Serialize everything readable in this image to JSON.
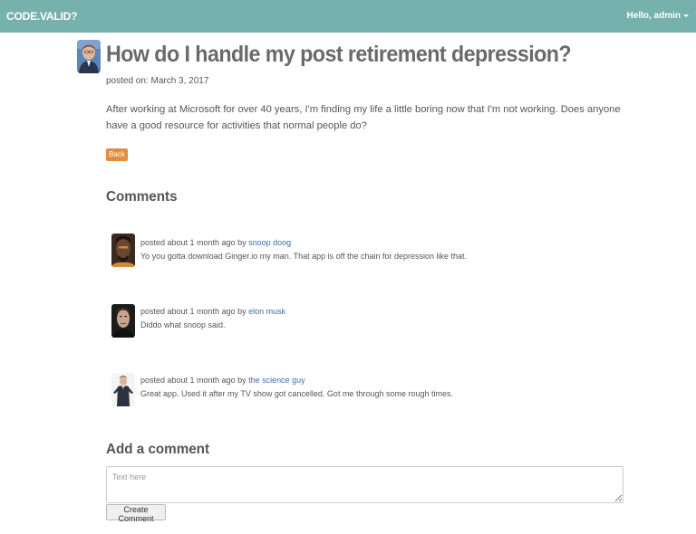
{
  "navbar": {
    "brand": "CODE.VALID?",
    "user_greeting": "Hello, admin"
  },
  "post": {
    "title": "How do I handle my post retirement depression?",
    "posted_on": "posted on: March 3, 2017",
    "body": "After working at Microsoft for over 40 years, I'm finding my life a little boring now that I'm not working. Does anyone have a good resource for activities that normal people do?",
    "back_label": "Back"
  },
  "comments_heading": "Comments",
  "comments": [
    {
      "meta": "posted about 1 month ago by ",
      "author": "snoop doog",
      "text": "Yo you gotta download Ginger.io my man. That app is off the chain for depression like that."
    },
    {
      "meta": "posted about 1 month ago by ",
      "author": "elon musk",
      "text": "Diddo what snoop said."
    },
    {
      "meta": "posted about 1 month ago by ",
      "author": "the science guy",
      "text": "Great app. Used it after my TV show got cancelled. Got me through some rough times."
    }
  ],
  "add_comment": {
    "heading": "Add a comment",
    "placeholder": "Text here",
    "submit_label": "Create Comment"
  },
  "colors": {
    "navbar": "#76b1ad",
    "back_button": "#e38d3c",
    "link": "#3d6ba8"
  }
}
